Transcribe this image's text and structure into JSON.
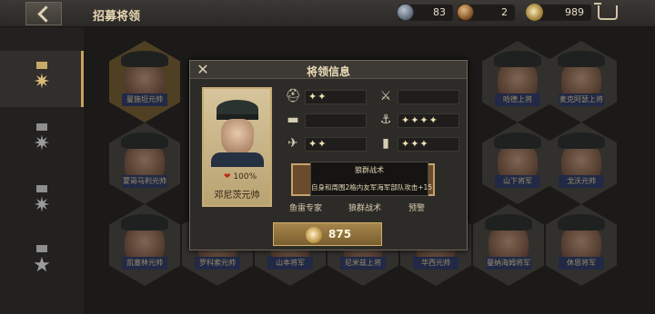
{
  "header": {
    "title": "招募将领"
  },
  "resources": [
    {
      "name": "medal",
      "icon": "silver-medal-icon",
      "value": "83"
    },
    {
      "name": "bronze",
      "icon": "bronze-medal-icon",
      "value": "2"
    },
    {
      "name": "honor",
      "icon": "star-medal-icon",
      "value": "989"
    }
  ],
  "rail": {
    "items": [
      "rank-5",
      "rank-4",
      "rank-3",
      "rank-2"
    ]
  },
  "generals": [
    {
      "name": "曼施坦元帅"
    },
    {
      "name": ""
    },
    {
      "name": ""
    },
    {
      "name": ""
    },
    {
      "name": ""
    },
    {
      "name": ""
    },
    {
      "name": "哈德上将"
    },
    {
      "name": "麦克阿瑟上将"
    },
    {
      "name": "蒙哥马利元帅"
    },
    {
      "name": ""
    },
    {
      "name": ""
    },
    {
      "name": ""
    },
    {
      "name": ""
    },
    {
      "name": ""
    },
    {
      "name": "山下将军"
    },
    {
      "name": "戈沃元帅"
    },
    {
      "name": "凯塞林元帅"
    },
    {
      "name": "罗科索元帅"
    },
    {
      "name": "山本将军"
    },
    {
      "name": "尼米兹上将"
    },
    {
      "name": "华西元帅"
    },
    {
      "name": "曼纳海姆将军"
    },
    {
      "name": "休恩将军"
    }
  ],
  "dialog": {
    "title": "将领信息",
    "close": "✕",
    "general": {
      "name": "邓尼茨元帅",
      "hp": "100%"
    },
    "stats": [
      {
        "icon": "infantry-icon",
        "glyph": "⛑",
        "pips": "✦✦"
      },
      {
        "icon": "artillery-icon",
        "glyph": "⚔",
        "pips": ""
      },
      {
        "icon": "tank-icon",
        "glyph": "▬",
        "pips": ""
      },
      {
        "icon": "navy-anchor-icon",
        "glyph": "⚓",
        "pips": "✦✦✦✦"
      },
      {
        "icon": "airforce-icon",
        "glyph": "✈",
        "pips": "✦✦"
      },
      {
        "icon": "submarine-boot-icon",
        "glyph": "▮",
        "pips": "✦✦✦"
      }
    ],
    "tooltip": {
      "title": "狼群战术",
      "desc": "自身和周围2格内友军海军部队攻击+15"
    },
    "skills": [
      {
        "label": "鱼雷专家"
      },
      {
        "label": "狼群战术"
      },
      {
        "label": "预警"
      }
    ],
    "cost": {
      "value": "875",
      "icon": "star-medal-icon"
    }
  },
  "colors": {
    "accent": "#c9a35c",
    "name_plate": "#343f6c",
    "dialog_bg": "#2d2b28"
  }
}
